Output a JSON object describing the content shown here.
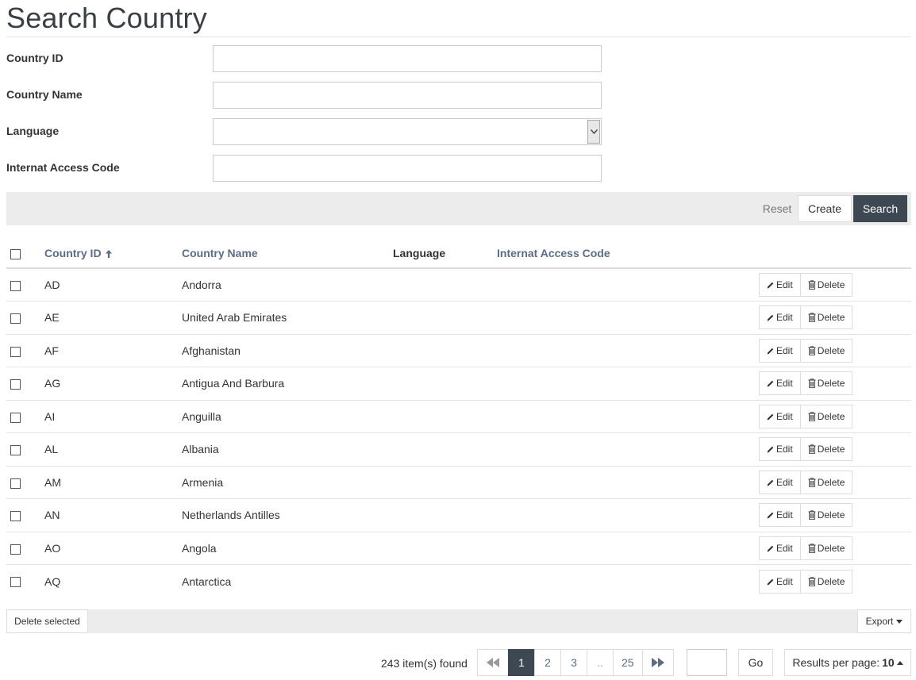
{
  "page": {
    "title": "Search Country"
  },
  "form": {
    "country_id": {
      "label": "Country ID",
      "value": ""
    },
    "country_name": {
      "label": "Country Name",
      "value": ""
    },
    "language": {
      "label": "Language",
      "selected": ""
    },
    "access_code": {
      "label": "Internat Access Code",
      "value": ""
    }
  },
  "toolbar": {
    "reset": "Reset",
    "create": "Create",
    "search": "Search"
  },
  "table": {
    "columns": {
      "country_id": "Country ID",
      "country_name": "Country Name",
      "language": "Language",
      "access_code": "Internat Access Code"
    },
    "sort": {
      "column": "Country ID",
      "direction": "ascending",
      "icon": "arrow-up-icon"
    },
    "edit_label": "Edit",
    "delete_label": "Delete",
    "rows": [
      {
        "id": "AD",
        "name": "Andorra",
        "language": "",
        "code": ""
      },
      {
        "id": "AE",
        "name": "United Arab Emirates",
        "language": "",
        "code": ""
      },
      {
        "id": "AF",
        "name": "Afghanistan",
        "language": "",
        "code": ""
      },
      {
        "id": "AG",
        "name": "Antigua And Barbura",
        "language": "",
        "code": ""
      },
      {
        "id": "AI",
        "name": "Anguilla",
        "language": "",
        "code": ""
      },
      {
        "id": "AL",
        "name": "Albania",
        "language": "",
        "code": ""
      },
      {
        "id": "AM",
        "name": "Armenia",
        "language": "",
        "code": ""
      },
      {
        "id": "AN",
        "name": "Netherlands Antilles",
        "language": "",
        "code": ""
      },
      {
        "id": "AO",
        "name": "Angola",
        "language": "",
        "code": ""
      },
      {
        "id": "AQ",
        "name": "Antarctica",
        "language": "",
        "code": ""
      }
    ]
  },
  "bulk": {
    "delete_selected": "Delete selected",
    "export": "Export"
  },
  "pagination": {
    "found": "243 item(s) found",
    "pages": [
      "1",
      "2",
      "3",
      "..",
      "25"
    ],
    "current": "1",
    "goto_value": "",
    "go": "Go",
    "results_label": "Results per page:",
    "results_value": "10"
  },
  "colors": {
    "dark": "#3e4852",
    "link": "#5b6d84",
    "bar": "#ececec"
  }
}
